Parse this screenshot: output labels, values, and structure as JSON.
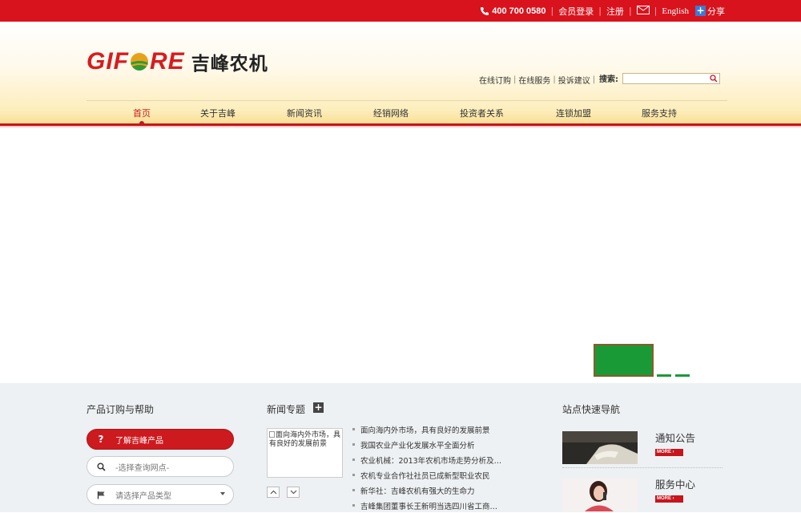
{
  "topbar": {
    "phone": "400 700 0580",
    "login": "会员登录",
    "register": "注册",
    "english": "English",
    "share": "分享"
  },
  "logo": {
    "en_left": "GIF",
    "en_right": "RE",
    "cn": "吉峰农机"
  },
  "quicklinks": [
    "在线订购",
    "在线服务",
    "投诉建议"
  ],
  "search": {
    "label": "搜索:",
    "value": ""
  },
  "nav": {
    "items": [
      "首页",
      "关于吉峰",
      "新闻资讯",
      "经销网络",
      "投资者关系",
      "连锁加盟",
      "服务支持"
    ],
    "active_index": 0
  },
  "banner": {
    "active_slide": 0,
    "slide_count": 3
  },
  "help": {
    "title": "产品订购与帮助",
    "learn_label": "了解吉峰产品",
    "site_placeholder": "-选择查询网点-",
    "type_placeholder": "请选择产品类型"
  },
  "news": {
    "title": "新闻专题",
    "thumb_alt": "面向海内外市场，具有良好的发展前景",
    "items": [
      "面向海内外市场，具有良好的发展前景",
      "我国农业产业化发展水平全面分析",
      "农业机械：2013年农机市场走势分析及…",
      "农机专业合作社社员已成新型职业农民",
      "新华社：吉峰农机有强大的生命力",
      "吉峰集团董事长王新明当选四川省工商…"
    ]
  },
  "quicknav": {
    "title": "站点快速导航",
    "items": [
      {
        "label": "通知公告",
        "more": "MORE"
      },
      {
        "label": "服务中心",
        "more": "MORE"
      }
    ]
  },
  "colors": {
    "brand_red": "#d9131d",
    "banner_green": "#1a9a37"
  }
}
